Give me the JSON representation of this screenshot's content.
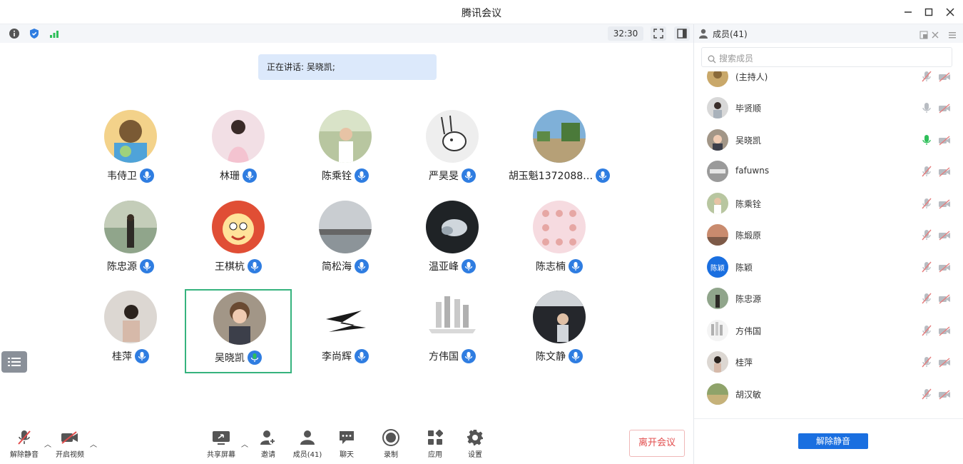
{
  "window": {
    "title": "腾讯会议"
  },
  "infobar": {
    "timer": "32:30"
  },
  "main": {
    "speaking": "正在讲话: 吴晓凯;",
    "participants": [
      {
        "name": "韦侍卫",
        "mic": "muted"
      },
      {
        "name": "林珊",
        "mic": "muted"
      },
      {
        "name": "陈乘铨",
        "mic": "muted"
      },
      {
        "name": "严昊旻",
        "mic": "muted"
      },
      {
        "name": "胡玉魁1372088…",
        "mic": "muted"
      },
      {
        "name": "陈忠源",
        "mic": "muted"
      },
      {
        "name": "王棋杭",
        "mic": "muted"
      },
      {
        "name": "简松海",
        "mic": "muted"
      },
      {
        "name": "温亚峰",
        "mic": "muted"
      },
      {
        "name": "陈志楠",
        "mic": "muted"
      },
      {
        "name": "桂萍",
        "mic": "muted"
      },
      {
        "name": "吴晓凯",
        "mic": "speaking",
        "active": true
      },
      {
        "name": "李尚辉",
        "mic": "muted"
      },
      {
        "name": "方伟国",
        "mic": "muted"
      },
      {
        "name": "陈文静",
        "mic": "muted"
      }
    ]
  },
  "toolbar": {
    "unmute": "解除静音",
    "start_video": "开启视频",
    "share_screen": "共享屏幕",
    "invite": "邀请",
    "members": "成员(41)",
    "chat": "聊天",
    "record": "录制",
    "apps": "应用",
    "settings": "设置",
    "leave": "离开会议"
  },
  "panel": {
    "title": "成员(41)",
    "search_placeholder": "搜索成员",
    "members": [
      {
        "name": "(主持人)",
        "mic": "muted"
      },
      {
        "name": "毕贤顺",
        "mic": "on"
      },
      {
        "name": "吴晓凯",
        "mic": "speaking"
      },
      {
        "name": "fafuwns",
        "mic": "muted"
      },
      {
        "name": "陈乘铨",
        "mic": "muted"
      },
      {
        "name": "陈煅原",
        "mic": "muted"
      },
      {
        "name": "陈颖",
        "mic": "muted",
        "avatar_text": "陈颖"
      },
      {
        "name": "陈忠源",
        "mic": "muted"
      },
      {
        "name": "方伟国",
        "mic": "muted"
      },
      {
        "name": "桂萍",
        "mic": "muted"
      },
      {
        "name": "胡汉敏",
        "mic": "muted"
      }
    ],
    "unmute_all": "解除静音"
  },
  "colors": {
    "accent": "#2f7de1",
    "speaking_mic": "#2fbf5a",
    "leave": "#e24b4b",
    "active_border": "#36b37e"
  }
}
